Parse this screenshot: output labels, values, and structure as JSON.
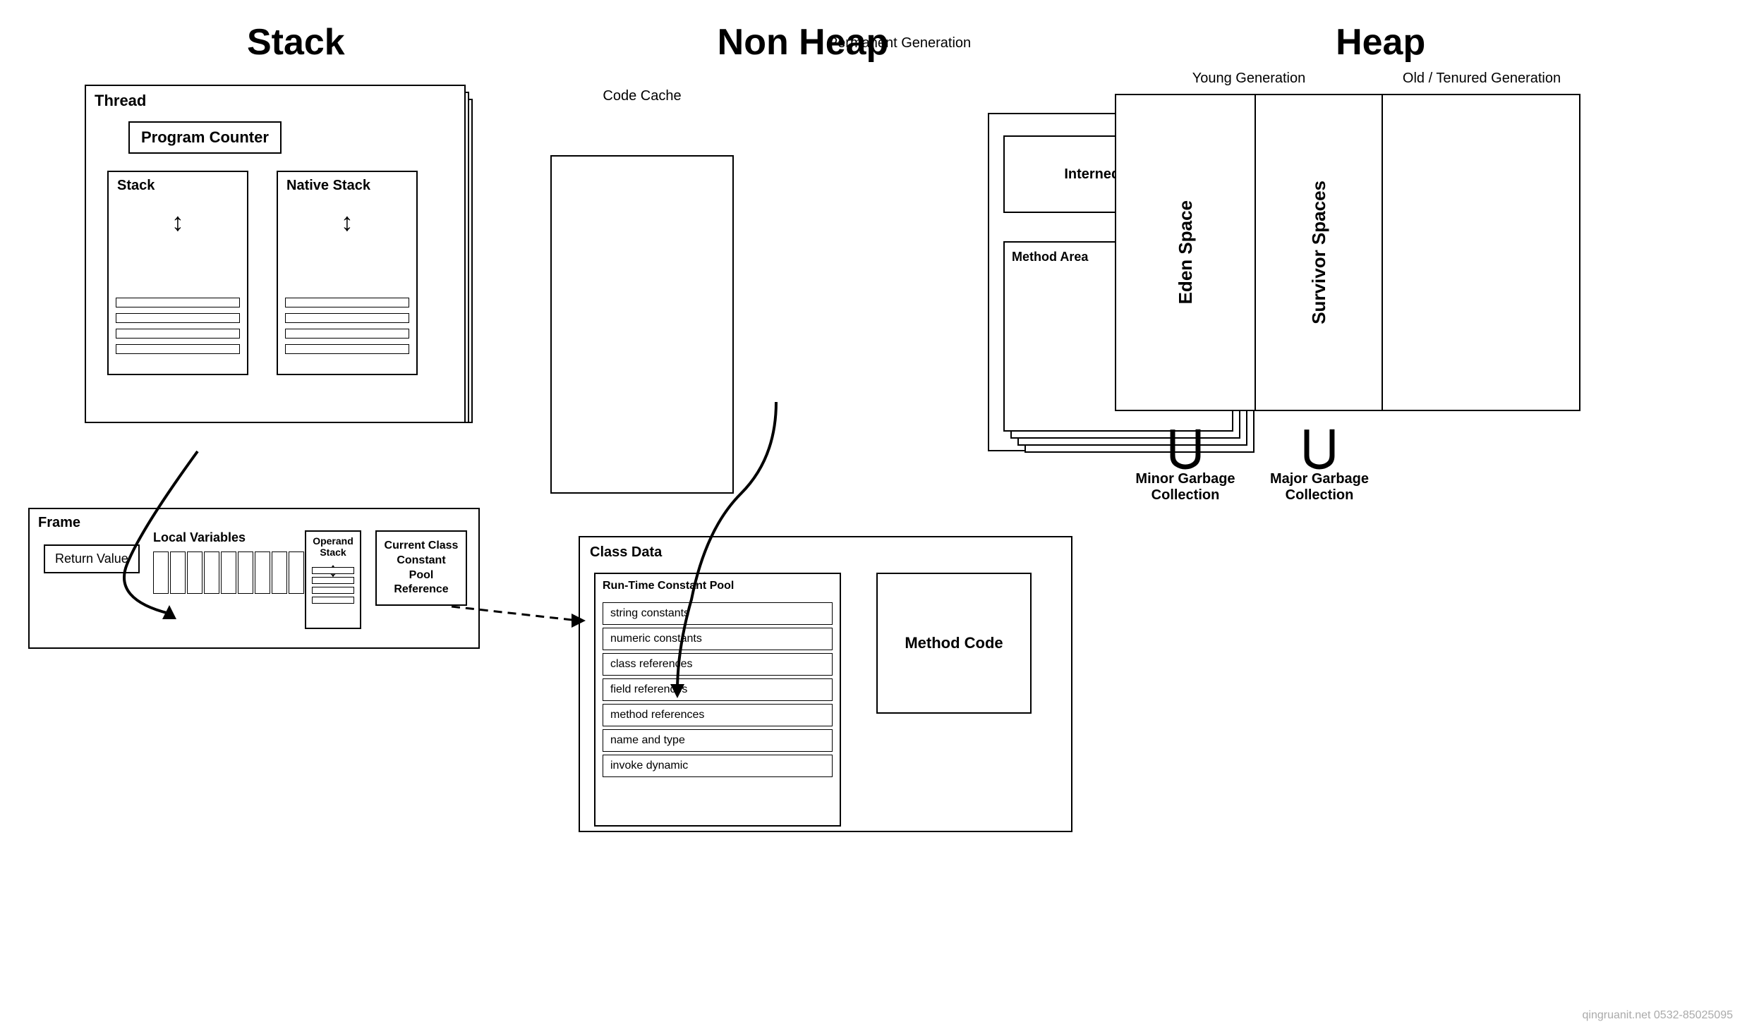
{
  "titles": {
    "stack": "Stack",
    "nonheap": "Non Heap",
    "heap": "Heap"
  },
  "stack": {
    "thread_label": "Thread",
    "program_counter": "Program Counter",
    "stack_label": "Stack",
    "native_stack_label": "Native Stack"
  },
  "frame": {
    "label": "Frame",
    "return_value": "Return Value",
    "local_variables": "Local Variables",
    "operand_stack": "Operand Stack",
    "current_class": "Current Class Constant Pool Reference"
  },
  "nonheap": {
    "code_cache_label": "Code Cache",
    "perm_gen_label": "Permanent Generation",
    "interned_strings": "Interned Strings",
    "method_area": "Method Area"
  },
  "heap": {
    "young_gen_label": "Young Generation",
    "old_gen_label": "Old / Tenured Generation",
    "eden_space": "Eden Space",
    "survivor_spaces": "Survivor Spaces",
    "minor_gc": "Minor Garbage Collection",
    "major_gc": "Major Garbage Collection"
  },
  "classdata": {
    "label": "Class Data",
    "runtime_pool_label": "Run-Time Constant Pool",
    "method_code": "Method Code",
    "pool_items": [
      "string constants",
      "numeric constants",
      "class references",
      "field references",
      "method references",
      "name and type",
      "invoke dynamic"
    ]
  },
  "watermark": "qingruanit.net 0532-85025095"
}
